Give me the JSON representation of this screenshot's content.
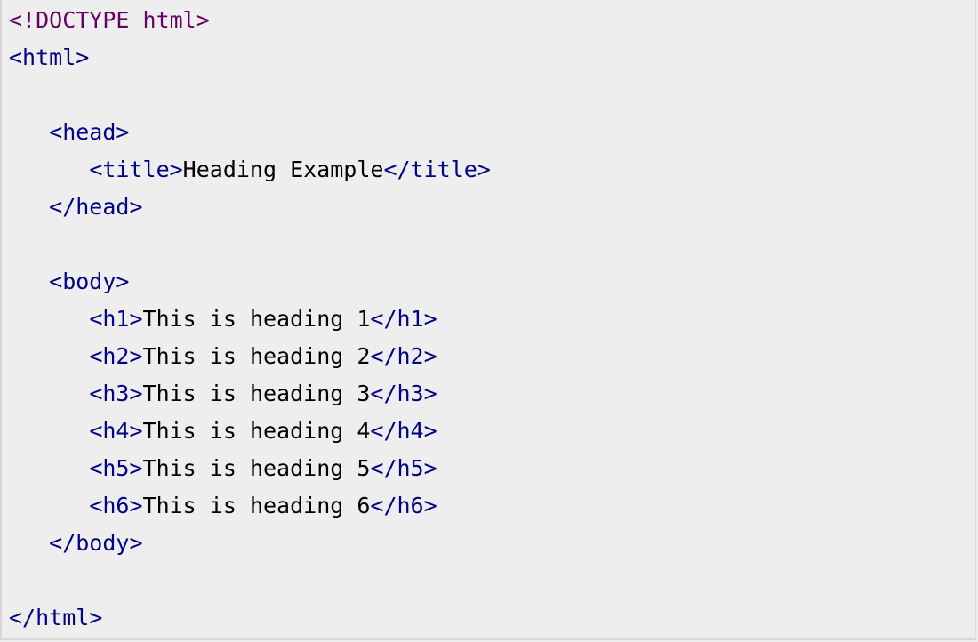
{
  "colors": {
    "background": "#eeeeee",
    "tag": "#000088",
    "declaration": "#660066",
    "text": "#000000"
  },
  "code": {
    "doctype": "<!DOCTYPE html>",
    "html_open": "<html>",
    "head_open": "<head>",
    "title_open": "<title>",
    "title_text": "Heading Example",
    "title_close": "</title>",
    "head_close": "</head>",
    "body_open": "<body>",
    "headings": [
      {
        "open": "<h1>",
        "text": "This is heading 1",
        "close": "</h1>"
      },
      {
        "open": "<h2>",
        "text": "This is heading 2",
        "close": "</h2>"
      },
      {
        "open": "<h3>",
        "text": "This is heading 3",
        "close": "</h3>"
      },
      {
        "open": "<h4>",
        "text": "This is heading 4",
        "close": "</h4>"
      },
      {
        "open": "<h5>",
        "text": "This is heading 5",
        "close": "</h5>"
      },
      {
        "open": "<h6>",
        "text": "This is heading 6",
        "close": "</h6>"
      }
    ],
    "body_close": "</body>",
    "html_close": "</html>"
  }
}
